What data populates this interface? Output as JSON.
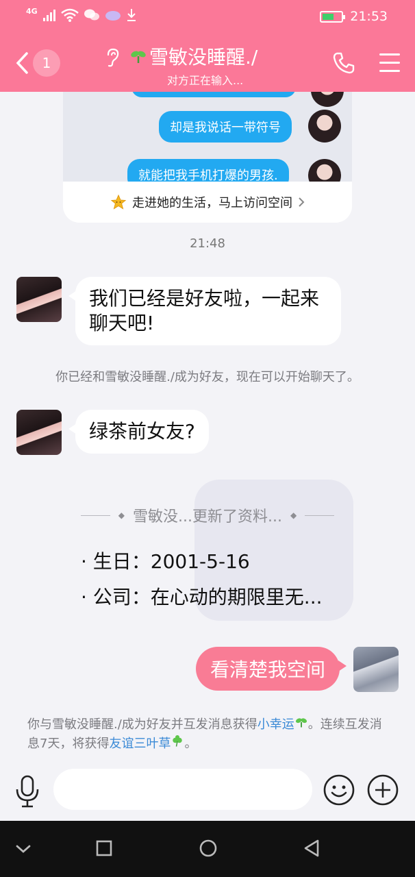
{
  "status_bar": {
    "network": "4G",
    "time": "21:53",
    "icons": [
      "signal-icon",
      "wifi-icon",
      "wechat-icon",
      "cloud-icon",
      "download-icon",
      "battery-icon"
    ]
  },
  "header": {
    "back_badge": "1",
    "title": "雪敏没睡醒./",
    "subtitle": "对方正在输入...",
    "accent": "#fb7898"
  },
  "zone_card": {
    "preview_bubbles": [
      "却是我说话一带符号",
      "就能把我手机打爆的男孩."
    ],
    "link_text": "走进她的生活，马上访问空间"
  },
  "messages": {
    "time_label": "21:48",
    "msg1": "我们已经是好友啦，一起来聊天吧!",
    "system1": "你已经和雪敏没睡醒./成为好友，现在可以开始聊天了。",
    "msg2": "绿茶前女友?",
    "update": {
      "header": "雪敏没...更新了资料...",
      "birthday": "· 生日：2001-5-16",
      "company": "· 公司：在心动的期限里无..."
    },
    "my_msg": "看清楚我空间",
    "system2": {
      "part1": "你与雪敏没睡醒./成为好友并互发消息获得",
      "link1": "小幸运",
      "part2": "。连续互发消息7天，将获得",
      "link2": "友谊三叶草",
      "part3": "。"
    }
  },
  "input": {
    "placeholder": ""
  }
}
